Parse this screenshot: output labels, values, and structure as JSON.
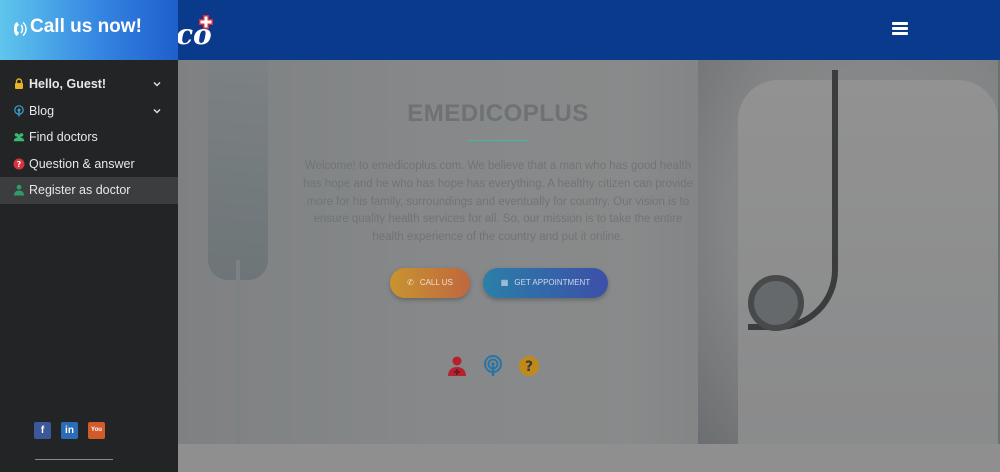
{
  "navbar": {
    "brand_text": "co",
    "menu_icon": "hamburger-icon"
  },
  "sidebar": {
    "call_label": "Call us now!",
    "call_icon": "phone-ring-icon",
    "items": [
      {
        "label": "Hello, Guest!",
        "icon": "user-lock-icon",
        "has_dropdown": true
      },
      {
        "label": "Blog",
        "icon": "podcast-icon",
        "has_dropdown": true
      },
      {
        "label": "Find doctors",
        "icon": "users-icon",
        "has_dropdown": false
      },
      {
        "label": "Question & answer",
        "icon": "question-circle-icon",
        "has_dropdown": false
      },
      {
        "label": "Register as doctor",
        "icon": "user-md-icon",
        "has_dropdown": false,
        "active": true
      }
    ],
    "social": {
      "facebook": "f",
      "linkedin": "in",
      "youtube": "You"
    }
  },
  "hero": {
    "title": "EMEDICOPLUS",
    "text": "Welcome! to emedicoplus.com. We believe that a man who has good health has hope and he who has hope has everything. A healthy citizen can provide more for his family, surroundings and eventually for country. Our vision is to ensure quality health services for all. So, our mission is to take the entire health experience of the country and put it online.",
    "call_button": "CALL US",
    "appointment_button": "GET APPOINTMENT",
    "icons": [
      "user-md-icon",
      "podcast-icon",
      "question-circle-icon"
    ]
  },
  "colors": {
    "navbar": "#0a3a8c",
    "sidebar": "#232425",
    "accent": "#3fb8a6"
  }
}
